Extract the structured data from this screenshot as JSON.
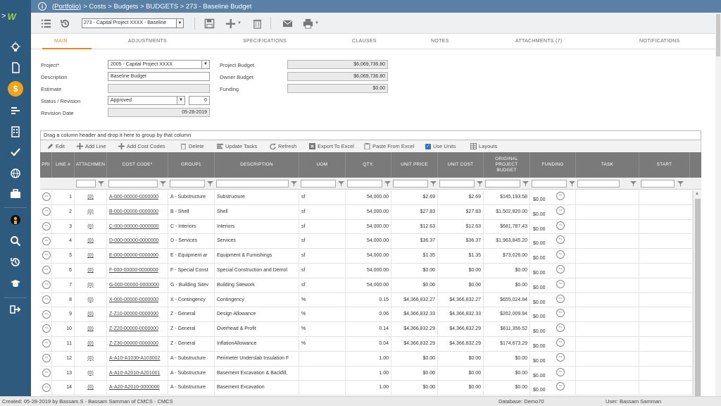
{
  "header": {
    "portfolio_link": "(Portfolio)",
    "breadcrumb": "> Costs > Budgets > BUDGETS > 273 - Baseline Budget"
  },
  "toolbar": {
    "record_select": "273 - Capital Project XXXX - Baseline"
  },
  "tabs": [
    "MAIN",
    "ADJUSTMENTS",
    "SPECIFICATIONS",
    "CLAUSES",
    "NOTES",
    "ATTACHMENTS (7)",
    "NOTIFICATIONS"
  ],
  "form": {
    "project_label": "Project*",
    "project_value": "2005 - Capital Project XXXX",
    "description_label": "Description",
    "description_value": "Baseline Budget",
    "estimate_label": "Estimate",
    "estimate_value": "",
    "status_label": "Status / Revision",
    "status_value": "Approved",
    "revision_value": "0",
    "revision_date_label": "Revision Date",
    "revision_date_value": "05-28-2019",
    "project_budget_label": "Project Budget",
    "project_budget_value": "$6,069,736.80",
    "owner_budget_label": "Owner Budget",
    "owner_budget_value": "$6,069,736.80",
    "funding_label": "Funding",
    "funding_value": "$0.00"
  },
  "grid": {
    "drag_hint": "Drag a column header and drop it here to group by that column",
    "toolbar": {
      "edit": "Edit",
      "add_line": "Add Line",
      "add_cost_codes": "Add Cost Codes",
      "delete": "Delete",
      "update_tasks": "Update Tasks",
      "refresh": "Refresh",
      "export": "Export To Excel",
      "paste": "Paste From Excel",
      "use_units": "Use Units",
      "layouts": "Layouts"
    },
    "columns": {
      "pri": "PRI",
      "line": "LINE #",
      "attach": "ATTACHMEN",
      "cost_code": "COST CODE*",
      "group1": "GROUP1",
      "description": "DESCRIPTION",
      "uom": "UOM",
      "qty": "QTY.",
      "unit_price": "UNIT PRICE",
      "unit_cost": "UNIT COST",
      "orig_budget": "ORIGINAL PROJECT BUDGET",
      "funding": "FUNDING",
      "task": "TASK",
      "start": "START"
    },
    "rows": [
      {
        "line": "1",
        "attach": "(0)",
        "code": "A-000-00000-0000000",
        "group": "A - Substructure",
        "desc": "Substructure",
        "uom": "sf",
        "qty": "54,000.00",
        "price": "$2.69",
        "cost": "$2.69",
        "budget": "$145,193.58",
        "funding": "$0.00"
      },
      {
        "line": "2",
        "attach": "(0)",
        "code": "B-000-00000-0000000",
        "group": "B - Shell",
        "desc": "Shell",
        "uom": "sf",
        "qty": "54,000.00",
        "price": "$27.83",
        "cost": "$27.83",
        "budget": "$1,502,820.00",
        "funding": "$0.00"
      },
      {
        "line": "3",
        "attach": "(0)",
        "code": "C-000-00000-0000000",
        "group": "C - Interiors",
        "desc": "Interiors",
        "uom": "sf",
        "qty": "54,000.00",
        "price": "$12.63",
        "cost": "$12.63",
        "budget": "$681,787.43",
        "funding": "$0.00"
      },
      {
        "line": "4",
        "attach": "(0)",
        "code": "D-000-00000-0000000",
        "group": "D - Services",
        "desc": "Services",
        "uom": "sf",
        "qty": "54,000.00",
        "price": "$36.37",
        "cost": "$36.37",
        "budget": "$1,963,845.20",
        "funding": "$0.00"
      },
      {
        "line": "5",
        "attach": "(0)",
        "code": "E-000-00000-0000000",
        "group": "E - Equipment ar",
        "desc": "Equipment & Furnishings",
        "uom": "sf",
        "qty": "54,000.00",
        "price": "$1.35",
        "cost": "$1.35",
        "budget": "$73,026.00",
        "funding": "$0.00"
      },
      {
        "line": "6",
        "attach": "(0)",
        "code": "F-000-00000-0000000",
        "group": "F - Special Const",
        "desc": "Special Construction and Demol",
        "uom": "sf",
        "qty": "54,000.00",
        "price": "$0.00",
        "cost": "$0.00",
        "budget": "$0.00",
        "funding": "$0.00"
      },
      {
        "line": "7",
        "attach": "(0)",
        "code": "G-000-00000-0000000",
        "group": "G - Building Sitev",
        "desc": "Building Sitework",
        "uom": "sf",
        "qty": "54,000.00",
        "price": "$0.00",
        "cost": "$0.00",
        "budget": "$0.00",
        "funding": "$0.00"
      },
      {
        "line": "8",
        "attach": "(0)",
        "code": "X-000-00000-0000000",
        "group": "X - Contingency",
        "desc": "Contingency",
        "uom": "%",
        "qty": "0.15",
        "price": "$4,366,832.27",
        "cost": "$4,366,832.27",
        "budget": "$655,024.84",
        "funding": "$0.00"
      },
      {
        "line": "9",
        "attach": "(0)",
        "code": "Z-Z10-00000-0000000",
        "group": "Z - General",
        "desc": "Design Allowance",
        "uom": "%",
        "qty": "0.06",
        "price": "$4,366,832.33",
        "cost": "$4,366,832.33",
        "budget": "$262,009.94",
        "funding": "$0.00"
      },
      {
        "line": "10",
        "attach": "(0)",
        "code": "Z-Z20-00000-0000000",
        "group": "Z - General",
        "desc": "Overhead & Profit",
        "uom": "%",
        "qty": "0.14",
        "price": "$4,366,832.29",
        "cost": "$4,366,832.29",
        "budget": "$611,356.52",
        "funding": "$0.00"
      },
      {
        "line": "11",
        "attach": "(0)",
        "code": "Z-Z30-00000-0000000",
        "group": "Z - General",
        "desc": "InflationAllowance",
        "uom": "%",
        "qty": "0.04",
        "price": "$4,366,832.29",
        "cost": "$4,366,832.29",
        "budget": "$174,673.29",
        "funding": "$0.00"
      },
      {
        "line": "12",
        "attach": "(0)",
        "code": "A-A10-A1030-A103002",
        "group": "A - Substructure",
        "desc": "Perimeter Underslab Insulation F",
        "uom": "",
        "qty": "1.00",
        "price": "$0.00",
        "cost": "$0.00",
        "budget": "$0.00",
        "funding": "$0.00"
      },
      {
        "line": "13",
        "attach": "(0)",
        "code": "A-A10-A2010-A201001",
        "group": "A - Substructure",
        "desc": "Basement Excavation & Backfill,",
        "uom": "",
        "qty": "1.00",
        "price": "$0.00",
        "cost": "$0.00",
        "budget": "$0.00",
        "funding": "$0.00"
      },
      {
        "line": "14",
        "attach": "(0)",
        "code": "A-A20-A2010-0000000",
        "group": "A - Substructure",
        "desc": "Basement Excavation",
        "uom": "",
        "qty": "1.00",
        "price": "$0.00",
        "cost": "$0.00",
        "budget": "$0.00",
        "funding": "$0.00"
      }
    ]
  },
  "statusbar": {
    "created": "Created:  05-28-2019 by Bassam.S - Bassam Samman of CMCS - CMCS",
    "database": "Database:   Demo70",
    "user": "User:   Bassam Samman"
  },
  "colors": {
    "sidebar": "#2e5a7e",
    "header": "#5a80a6",
    "accent": "#e08a1e",
    "grid_header": "#7a7a7a"
  }
}
